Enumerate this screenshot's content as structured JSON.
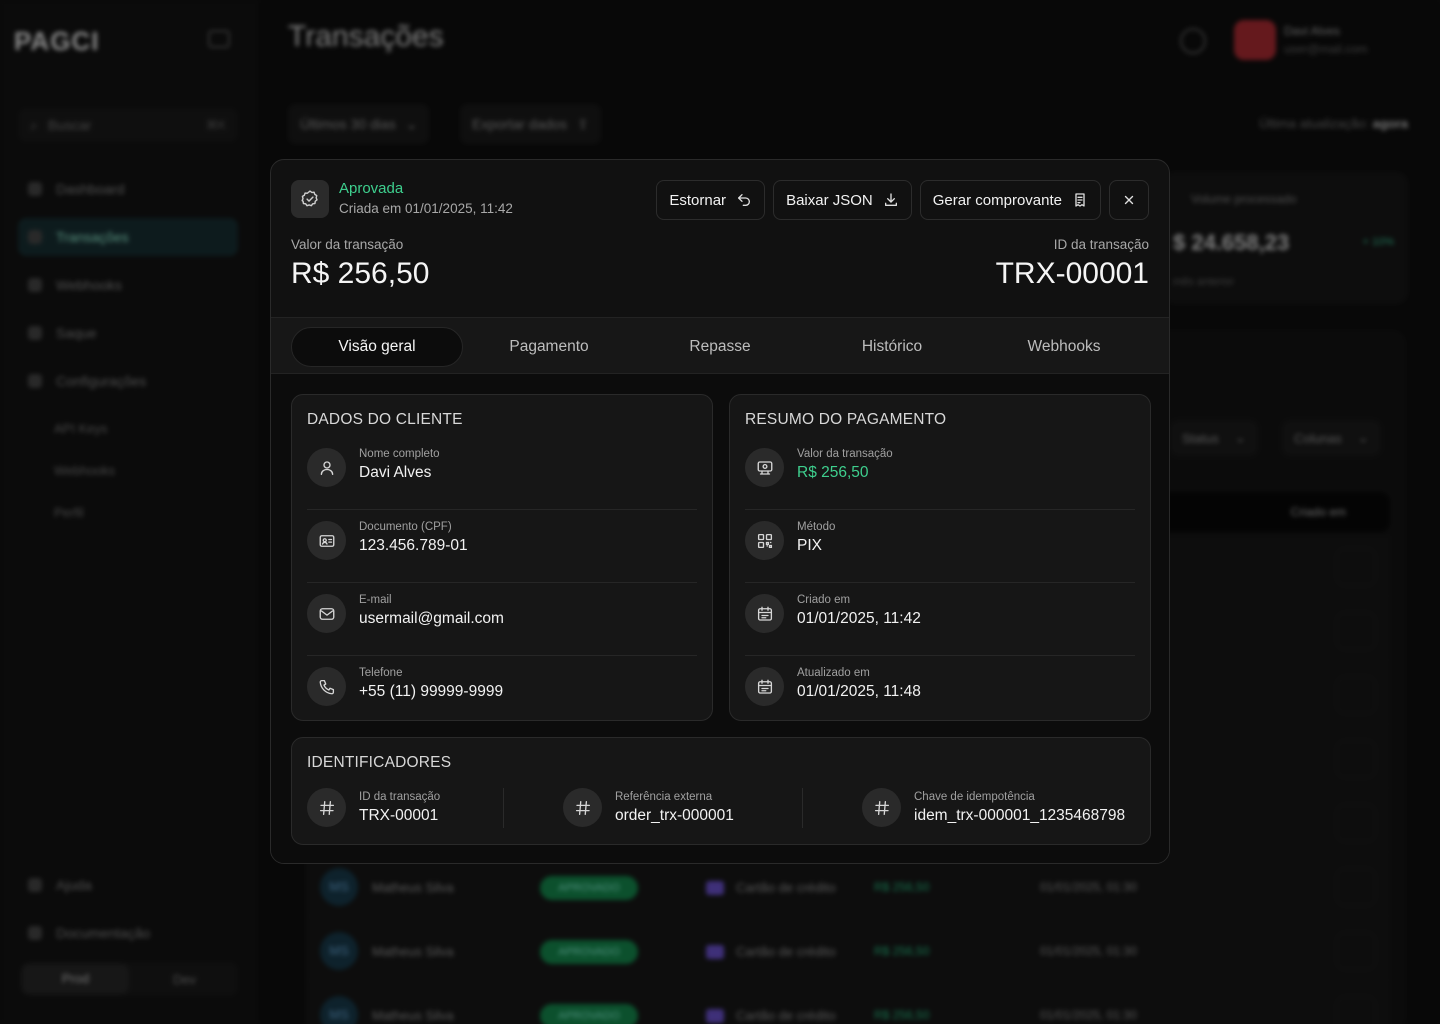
{
  "background": {
    "sidebar": {
      "logo": "PAGCI",
      "search_placeholder": "Buscar",
      "search_shortcut": "⌘K",
      "items": [
        {
          "label": "Dashboard",
          "active": false
        },
        {
          "label": "Transações",
          "active": true
        },
        {
          "label": "Webhooks",
          "active": false
        },
        {
          "label": "Saque",
          "active": false
        },
        {
          "label": "Configurações",
          "active": false
        }
      ],
      "sub_items": [
        {
          "label": "API Keys"
        },
        {
          "label": "Webhooks"
        },
        {
          "label": "Perfil"
        }
      ],
      "bottom_items": [
        {
          "label": "Ajuda"
        },
        {
          "label": "Documentação"
        }
      ],
      "env": {
        "prod": "Prod",
        "dev": "Dev"
      }
    },
    "header": {
      "title": "Transações",
      "user_name": "Davi Alves",
      "user_email": "user@mail.com"
    },
    "filters": {
      "period": "Últimos 30 dias",
      "export": "Exportar dados",
      "last_update_label": "Última atualização:",
      "last_update_value": "agora",
      "status": "Status",
      "columns": "Colunas"
    },
    "stat": {
      "label": "Volume processado",
      "value": "$ 24.658,23",
      "pct": "+ 10%",
      "sub": "mês anterior"
    },
    "table_header_created": "Criado em",
    "rows": [
      {
        "initials": "MS",
        "name": "Matheus Silva",
        "status": "APROVADO",
        "method": "Cartão de crédito",
        "amount": "R$ 256,50",
        "date": "01/01/2025, 01:30"
      },
      {
        "initials": "MS",
        "name": "Matheus Silva",
        "status": "APROVADO",
        "method": "Cartão de crédito",
        "amount": "R$ 256,50",
        "date": "01/01/2025, 01:30"
      },
      {
        "initials": "MS",
        "name": "Matheus Silva",
        "status": "APROVADO",
        "method": "Cartão de crédito",
        "amount": "R$ 256,50",
        "date": "01/01/2025, 01:30"
      }
    ]
  },
  "modal": {
    "status": "Aprovada",
    "created": "Criada em 01/01/2025, 11:42",
    "actions": {
      "refund": "Estornar",
      "download": "Baixar JSON",
      "receipt": "Gerar comprovante"
    },
    "amount_label": "Valor da transação",
    "amount_value": "R$ 256,50",
    "id_label": "ID da transação",
    "id_value": "TRX-00001",
    "tabs": [
      {
        "label": "Visão geral",
        "active": true
      },
      {
        "label": "Pagamento",
        "active": false
      },
      {
        "label": "Repasse",
        "active": false
      },
      {
        "label": "Histórico",
        "active": false
      },
      {
        "label": "Webhooks",
        "active": false
      }
    ],
    "customer": {
      "title": "DADOS DO CLIENTE",
      "fields": [
        {
          "label": "Nome completo",
          "value": "Davi Alves",
          "icon": "user-icon"
        },
        {
          "label": "Documento (CPF)",
          "value": "123.456.789-01",
          "icon": "id-card-icon"
        },
        {
          "label": "E-mail",
          "value": "usermail@gmail.com",
          "icon": "mail-icon"
        },
        {
          "label": "Telefone",
          "value": "+55 (11) 99999-9999",
          "icon": "phone-icon"
        }
      ]
    },
    "payment": {
      "title": "RESUMO DO PAGAMENTO",
      "fields": [
        {
          "label": "Valor da transação",
          "value": "R$ 256,50",
          "icon": "money-icon"
        },
        {
          "label": "Método",
          "value": "PIX",
          "icon": "qr-code-icon"
        },
        {
          "label": "Criado em",
          "value": "01/01/2025, 11:42",
          "icon": "calendar-icon"
        },
        {
          "label": "Atualizado em",
          "value": "01/01/2025, 11:48",
          "icon": "calendar-icon"
        }
      ]
    },
    "identifiers": {
      "title": "IDENTIFICADORES",
      "fields": [
        {
          "label": "ID da transação",
          "value": "TRX-00001",
          "icon": "hash-icon"
        },
        {
          "label": "Referência externa",
          "value": "order_trx-000001",
          "icon": "hash-icon"
        },
        {
          "label": "Chave de idempotência",
          "value": "idem_trx-000001_1235468798",
          "icon": "hash-icon"
        }
      ]
    },
    "colors": {
      "success": "#3ecf8e",
      "surface": "#111111",
      "card": "#161616"
    }
  }
}
